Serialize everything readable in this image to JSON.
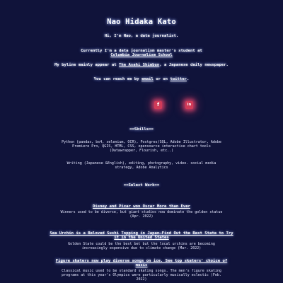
{
  "header": {
    "name": "Nao Hidaka Kato"
  },
  "intro": {
    "greeting": "Hi, I'm Nao, a data journalist.",
    "student_prefix": "Currently I'm a data journalism master's student at",
    "school_link": "Columbia Journalism School",
    "byline_prefix": "My byline mainly appear at ",
    "byline_link": "The Asahi Shimbun",
    "byline_suffix": ", a Japanese daily newspaper.",
    "reach_prefix": "You can reach me by ",
    "email_link": "email",
    "reach_middle": " or on ",
    "twitter_link": "twitter",
    "reach_suffix": "."
  },
  "social": {
    "facebook_glyph": "f",
    "linkedin_glyph": "in",
    "accent_color": "#d13b58"
  },
  "skills": {
    "heading": "==Skills==",
    "technical": "Python (pandas, bs4, selenium, OCR), Postgres/SQL, Adobe Illustrator, Adobe Premiere Pro, QGIS, HTML, CSS, opensource interactive chart tools (Datawrapper, Flourish, etc..)",
    "other": "Writing (Japanese &English), editing, photography, video. social media strategy, Adobe Analytics"
  },
  "work": {
    "heading": "==Select Work==",
    "items": [
      {
        "title": "Disney and Pixar won Oscar More than Ever",
        "desc": "Winners used to be diverse, but giant studios now dominate the golden statue (Apr. 2022)"
      },
      {
        "title": "Sea Urchin is a Beloved Sushi Topping in Japan—Find Out the Best State to Try it in the United States",
        "desc": "Golden State could be the best bet but the local urchins are becoming increasingly expensive due to climate change (Mar. 2022)"
      },
      {
        "title": "Figure skaters now play diverse songs on ice. See top skaters' choice of music",
        "desc": "Classical music used to be standard skating songs. The men's figure skating programs at this year's Olympics were particularly musically eclectic (Feb. 2022)"
      }
    ]
  },
  "theme": {
    "background": "#10133a",
    "text": "#ffffff"
  }
}
